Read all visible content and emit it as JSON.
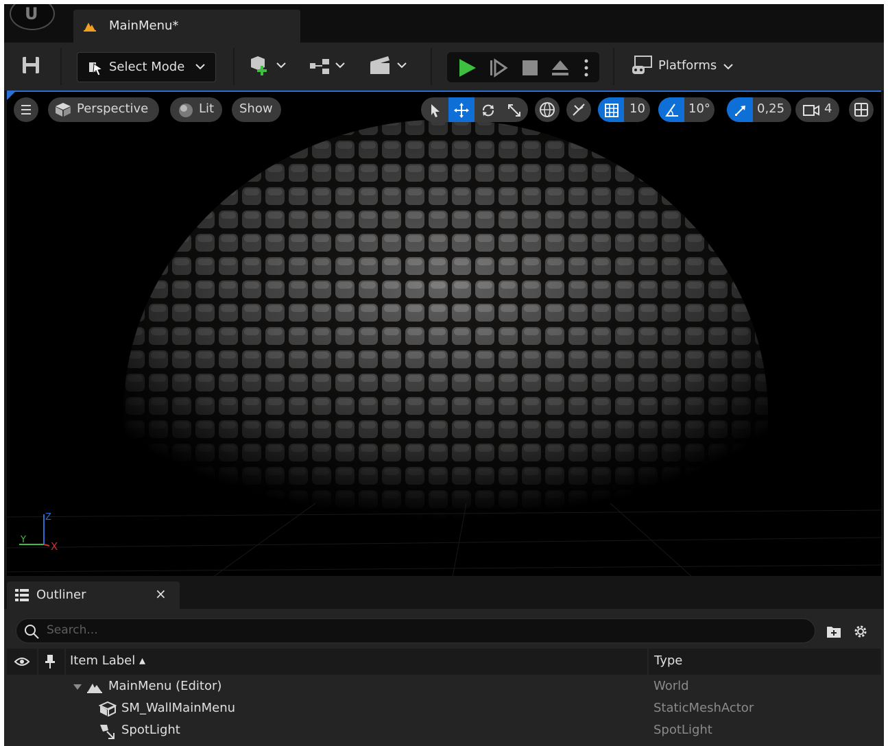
{
  "app": {
    "logo": "unreal-engine-logo",
    "document_tab": {
      "label": "MainMenu*",
      "icon": "level-icon"
    }
  },
  "toolbar": {
    "save": {
      "icon": "save-icon"
    },
    "select_mode": {
      "label": "Select Mode",
      "icon": "select-arrow-icon"
    },
    "add_actor": {
      "icon": "add-actor-icon"
    },
    "blueprints": {
      "icon": "blueprint-icon"
    },
    "cinematics": {
      "icon": "clapper-icon"
    },
    "play_controls": [
      "play-icon",
      "step-icon",
      "stop-icon",
      "eject-icon",
      "more-vertical-icon"
    ],
    "platforms": {
      "label": "Platforms",
      "icon": "platforms-icon"
    },
    "accent_colors": {
      "play": "#3fbf3f",
      "blue": "#0e70d6"
    }
  },
  "viewport": {
    "menu_icon": "hamburger-icon",
    "perspective": {
      "label": "Perspective",
      "icon": "cube-icon"
    },
    "lit": {
      "label": "Lit",
      "icon": "sphere-icon"
    },
    "show": {
      "label": "Show"
    },
    "transform_tools": [
      "select-icon",
      "move-icon",
      "rotate-icon",
      "scale-icon"
    ],
    "world_local": {
      "icon": "globe-icon"
    },
    "surface_snap": {
      "icon": "surface-snap-icon"
    },
    "grid_snap": {
      "value": "10",
      "icon": "grid-icon"
    },
    "rotation_snap": {
      "value": "10°",
      "icon": "angle-icon"
    },
    "scale_snap": {
      "value": "0,25",
      "icon": "scale-snap-icon"
    },
    "camera_speed": {
      "value": "4",
      "icon": "camera-icon"
    },
    "layout_icon": "viewport-layout-icon",
    "axis": {
      "x": "X",
      "y": "Y",
      "z": "Z"
    }
  },
  "outliner": {
    "tab_label": "Outliner",
    "close_label": "×",
    "search_placeholder": "Search...",
    "columns": {
      "label": "Item Label ▴",
      "type": "Type"
    },
    "rows": [
      {
        "label": "MainMenu (Editor)",
        "type": "World",
        "icon": "level-icon"
      },
      {
        "label": "SM_WallMainMenu",
        "type": "StaticMeshActor",
        "icon": "static-mesh-icon"
      },
      {
        "label": "SpotLight",
        "type": "SpotLight",
        "icon": "spotlight-icon"
      }
    ]
  }
}
